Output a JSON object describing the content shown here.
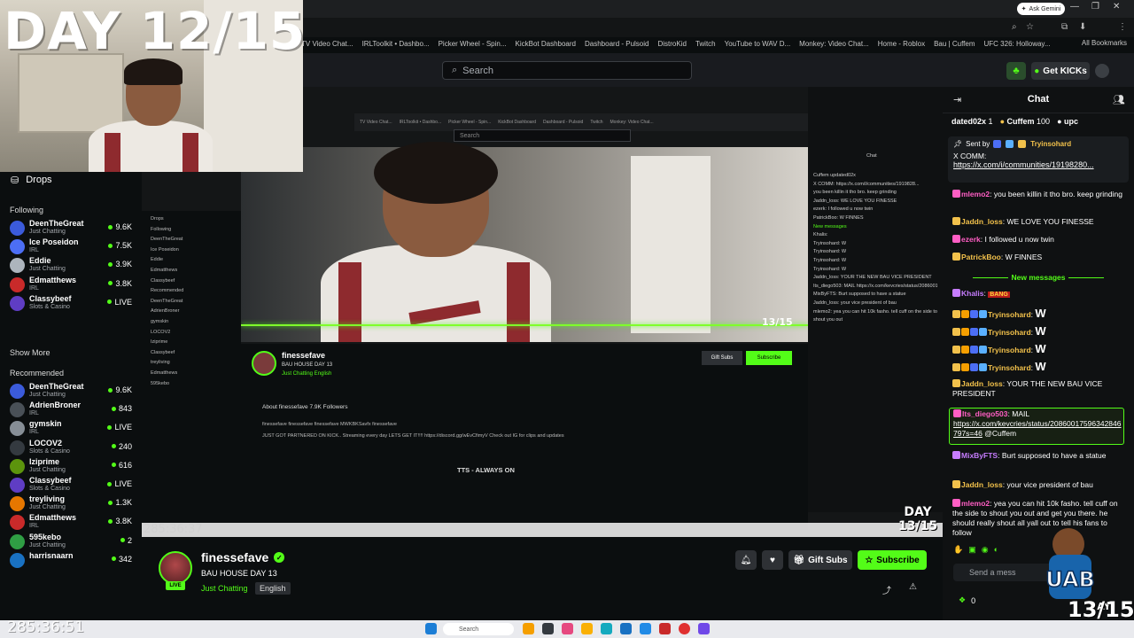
{
  "overlay": {
    "day_title": "DAY 12/15",
    "timestamp": "285:36:51",
    "video_timestamp": "285:36:37",
    "day_corner": "13/15",
    "video_day_badge": "DAY\n13/15"
  },
  "browser": {
    "ask_gemini": "Ask Gemini",
    "bookmarks": [
      "TV Video Chat...",
      "IRLToolkit • Dashbo...",
      "Picker Wheel - Spin...",
      "KickBot Dashboard",
      "Dashboard - Pulsoid",
      "DistroKid",
      "Twitch",
      "YouTube to WAV D...",
      "Monkey: Video Chat...",
      "Home - Roblox",
      "Bau | Cuffem",
      "UFC 326: Holloway..."
    ],
    "all_bookmarks": "All Bookmarks"
  },
  "header": {
    "search_placeholder": "Search",
    "get_kicks": "Get KICKs"
  },
  "sidebar": {
    "drops": "Drops",
    "following_heading": "Following",
    "following": [
      {
        "name": "DeenTheGreat",
        "category": "Just Chatting",
        "viewers": "9.6K",
        "color": "#3b5bdb"
      },
      {
        "name": "Ice Poseidon",
        "category": "IRL",
        "viewers": "7.5K",
        "color": "#4c6ef5"
      },
      {
        "name": "Eddie",
        "category": "Just Chatting",
        "viewers": "3.9K",
        "color": "#adb5bd"
      },
      {
        "name": "Edmatthews",
        "category": "IRL",
        "viewers": "3.8K",
        "color": "#c92a2a"
      },
      {
        "name": "Classybeef",
        "category": "Slots & Casino",
        "viewers": "LIVE",
        "color": "#5f3dc4"
      }
    ],
    "show_more": "Show More",
    "recommended_heading": "Recommended",
    "recommended": [
      {
        "name": "DeenTheGreat",
        "category": "Just Chatting",
        "viewers": "9.6K",
        "color": "#3b5bdb"
      },
      {
        "name": "AdrienBroner",
        "category": "IRL",
        "viewers": "843",
        "color": "#495057"
      },
      {
        "name": "gymskin",
        "category": "IRL",
        "viewers": "LIVE",
        "color": "#868e96"
      },
      {
        "name": "LOCOV2",
        "category": "Slots & Casino",
        "viewers": "240",
        "color": "#343a40"
      },
      {
        "name": "Iziprime",
        "category": "Just Chatting",
        "viewers": "616",
        "color": "#5c940d"
      },
      {
        "name": "Classybeef",
        "category": "Slots & Casino",
        "viewers": "LIVE",
        "color": "#5f3dc4"
      },
      {
        "name": "treyliving",
        "category": "Just Chatting",
        "viewers": "1.3K",
        "color": "#e67700"
      },
      {
        "name": "Edmatthews",
        "category": "IRL",
        "viewers": "3.8K",
        "color": "#c92a2a"
      },
      {
        "name": "595kebo",
        "category": "Just Chatting",
        "viewers": "2",
        "color": "#2f9e44"
      },
      {
        "name": "harrisnaarn",
        "category": "",
        "viewers": "342",
        "color": "#1971c2"
      }
    ]
  },
  "nested": {
    "search": "Search",
    "name": "finessefave",
    "title": "BAU HOUSE DAY 13",
    "category": "Just Chatting  English",
    "about": "About finessefave   7.9K Followers",
    "socials": "finessefave     finessefave     finessefave     MWKBKSavfx     finessefave",
    "bio": "JUST GOT PARTNERED ON KICK.. Streaming every day LETS GET IT!!!! https://discord.gg/wEvCfimyV Check out IG for clips and updates",
    "tts": "TTS - ALWAYS ON",
    "gift_subs": "Gift Subs",
    "subscribe": "Subscribe",
    "drops": "Drops",
    "following": "Following",
    "recommended": "Recommended",
    "chat_lines": [
      "Chat",
      "Cuffem   updated02x",
      "X COMM: https://x.com/i/communities/1919828...",
      "you been killin it tho bro. keep grinding",
      "Jaddn_loss: WE LOVE YOU FINESSE",
      "ezerk: I followed u now twin",
      "PatrickBoo: W FINNES",
      "New messages",
      "Khalis:",
      "Tryinsohard: W",
      "Tryinsohard: W",
      "Tryinsohard: W",
      "Tryinsohard: W",
      "Jaddn_loss: YOUR THE NEW BAU VICE PRESIDENT",
      "Its_diego503: MAIL https://x.com/kevcries/status/2086001759634284679?s=46",
      "MixByFTS: Burt supposed to have a statue",
      "Jaddn_loss: your vice president of bau",
      "mlemo2: yea you can hit 10k fasho. tell cuff on the side to shout you out"
    ]
  },
  "stream": {
    "live_badge": "LIVE",
    "name": "finessefave",
    "title": "BAU HOUSE DAY 13",
    "category": "Just Chatting",
    "language": "English",
    "gift_subs": "Gift Subs",
    "subscribe": "Subscribe"
  },
  "chat": {
    "title": "Chat",
    "top_gifters": [
      {
        "name": "dated02x",
        "count": "1"
      },
      {
        "name": "Cuffem",
        "count": "100"
      },
      {
        "name": "upc",
        "count": ""
      }
    ],
    "pinned_sent_by": "Sent by",
    "pinned_user": "Tryinsohard",
    "pinned_text": "X COMM:",
    "pinned_link": "https://x.com/i/communities/19198280...",
    "messages": [
      {
        "user": "mlemo2",
        "text": "you been killin it tho bro. keep grinding",
        "color": "#ff5ec4"
      },
      {
        "user": "Jaddn_loss",
        "text": "WE LOVE YOU FINESSE",
        "color": "#f2c14b"
      },
      {
        "user": "ezerk",
        "text": "I followed u now twin",
        "color": "#ff5ec4"
      },
      {
        "user": "PatrickBoo",
        "text": "W FINNES",
        "color": "#f2c14b"
      }
    ],
    "new_messages": "New messages",
    "khalis_user": "Khalis",
    "khalis_emote": "BANG",
    "w_messages": [
      {
        "user": "Tryinsohard",
        "text": "W"
      },
      {
        "user": "Tryinsohard",
        "text": "W"
      },
      {
        "user": "Tryinsohard",
        "text": "W"
      },
      {
        "user": "Tryinsohard",
        "text": "W"
      }
    ],
    "messages2": [
      {
        "user": "Jaddn_loss",
        "text": "YOUR THE NEW BAU VICE PRESIDENT",
        "color": "#f2c14b"
      }
    ],
    "highlight_user": "Its_diego503",
    "highlight_text": "MAIL",
    "highlight_link": "https://x.com/kevcries/status/20860017596342846797s=46",
    "highlight_mention": "@Cuffem",
    "messages3": [
      {
        "user": "MixByFTS",
        "text": "Burt supposed to have a statue",
        "color": "#c77dff"
      },
      {
        "user": "Jaddn_loss",
        "text": "your vice president of bau",
        "color": "#f2c14b"
      },
      {
        "user": "mlemo2",
        "text": "yea you can hit 10k fasho. tell cuff on the side to shout you out and get you there. he should really shout all yall out to tell his fans to follow",
        "color": "#ff5ec4"
      }
    ],
    "input_placeholder": "Send a mess",
    "points": "0"
  },
  "taskbar": {
    "search": "Search"
  },
  "mascot": {
    "text": "UAB",
    "sub": "AY"
  }
}
